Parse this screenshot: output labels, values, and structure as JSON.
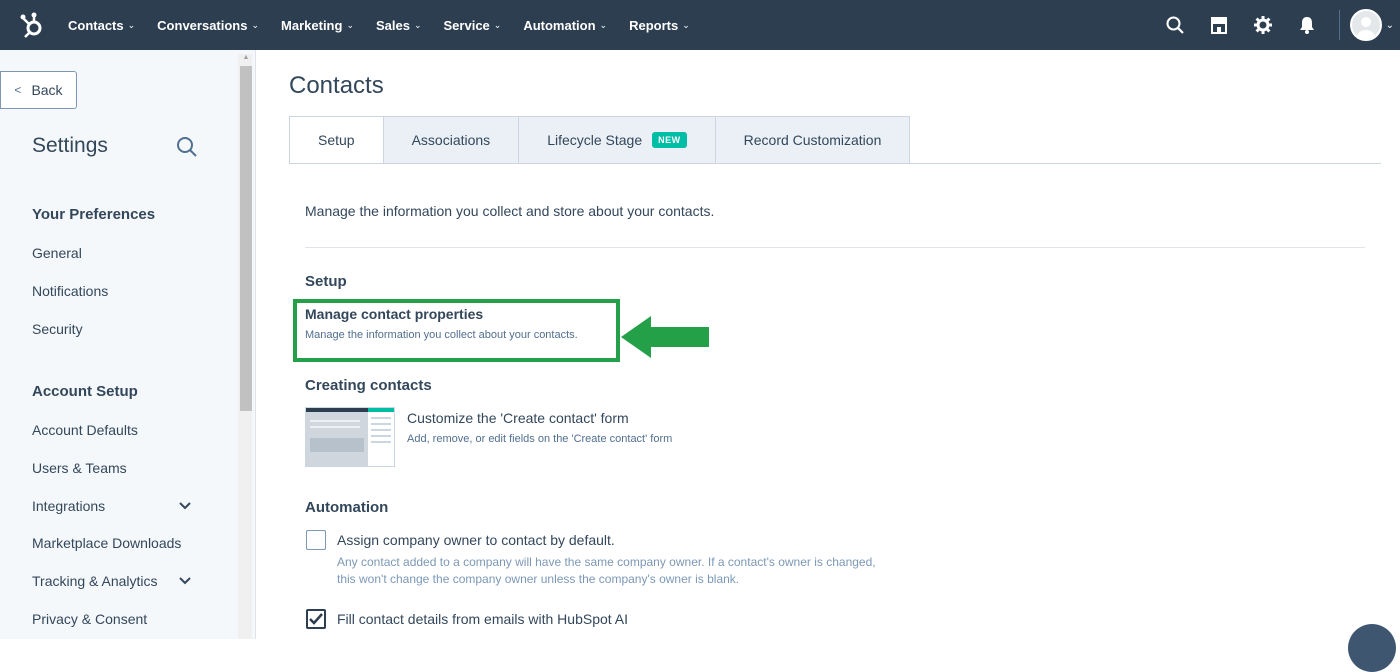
{
  "nav": {
    "items": [
      "Contacts",
      "Conversations",
      "Marketing",
      "Sales",
      "Service",
      "Automation",
      "Reports"
    ],
    "caret": "⌄"
  },
  "sidebar": {
    "back_label": "Back",
    "title": "Settings",
    "sections": [
      {
        "heading": "Your Preferences",
        "items": [
          "General",
          "Notifications",
          "Security"
        ]
      },
      {
        "heading": "Account Setup",
        "items": [
          "Account Defaults",
          "Users & Teams",
          "Integrations",
          "Marketplace Downloads",
          "Tracking & Analytics",
          "Privacy & Consent"
        ]
      }
    ]
  },
  "main": {
    "title": "Contacts",
    "tabs": [
      {
        "label": "Setup",
        "active": true
      },
      {
        "label": "Associations"
      },
      {
        "label": "Lifecycle Stage",
        "badge": "NEW"
      },
      {
        "label": "Record Customization"
      }
    ],
    "intro": "Manage the information you collect and store about your contacts.",
    "setup": {
      "heading": "Setup",
      "link_title": "Manage contact properties",
      "link_desc": "Manage the information you collect about your contacts."
    },
    "creating": {
      "heading": "Creating contacts",
      "link_title": "Customize the 'Create contact' form",
      "link_desc": "Add, remove, or edit fields on the 'Create contact' form"
    },
    "automation": {
      "heading": "Automation",
      "options": [
        {
          "label": "Assign company owner to contact by default.",
          "checked": false,
          "help": "Any contact added to a company will have the same company owner. If a contact's owner is changed, this won't change the company owner unless the company's owner is blank."
        },
        {
          "label": "Fill contact details from emails with HubSpot AI",
          "checked": true
        }
      ]
    }
  },
  "colors": {
    "nav_bg": "#2d3e50",
    "highlight": "#24a148",
    "badge": "#00bda5",
    "sidebar_bg": "#f5f8fa"
  }
}
